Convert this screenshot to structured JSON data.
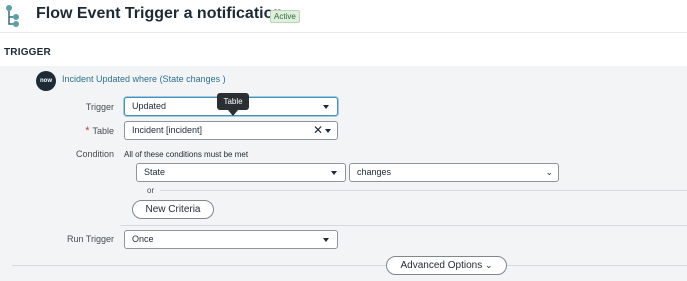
{
  "header": {
    "title": "Flow Event Trigger a notification",
    "status_badge": "Active",
    "icon": "flow-icon"
  },
  "section": {
    "label": "TRIGGER"
  },
  "trigger_summary": {
    "logo_text": "now",
    "text": "Incident Updated where (State changes )"
  },
  "form": {
    "trigger": {
      "label": "Trigger",
      "value": "Updated"
    },
    "table": {
      "label": "Table",
      "required_marker": "*",
      "value": "Incident [incident]",
      "tooltip": "Table"
    },
    "condition": {
      "label": "Condition",
      "note": "All of these conditions must be met",
      "field_value": "State",
      "operator_value": "changes",
      "or_label": "or",
      "new_criteria_label": "New Criteria"
    },
    "run_trigger": {
      "label": "Run Trigger",
      "value": "Once"
    },
    "advanced_options_label": "Advanced Options"
  },
  "colors": {
    "link": "#2f6f8f",
    "badge_bg": "#dfeedd",
    "panel_bg": "#f3f4f5",
    "focus": "#4a90b9",
    "required": "#c83c3c"
  }
}
